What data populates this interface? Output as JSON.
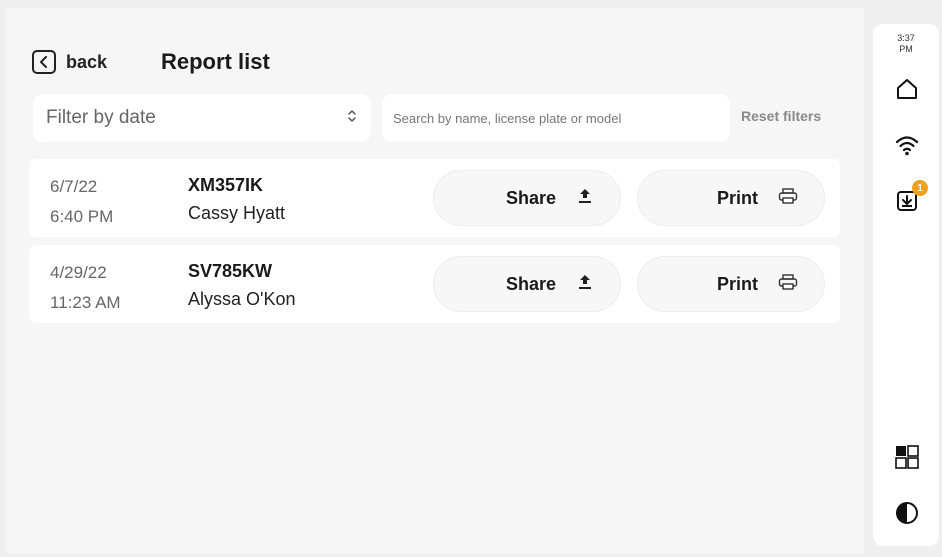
{
  "header": {
    "back_label": "back",
    "title": "Report list"
  },
  "filters": {
    "date_label": "Filter by date",
    "search_placeholder": "Search by name, license plate or model",
    "reset_label": "Reset filters"
  },
  "reports": [
    {
      "date": "6/7/22",
      "time": "6:40 PM",
      "plate": "XM357IK",
      "name": "Cassy Hyatt",
      "share_label": "Share",
      "print_label": "Print"
    },
    {
      "date": "4/29/22",
      "time": "11:23 AM",
      "plate": "SV785KW",
      "name": "Alyssa O'Kon",
      "share_label": "Share",
      "print_label": "Print"
    }
  ],
  "sidebar": {
    "time": "3:37",
    "ampm": "PM",
    "downloads_badge": "1",
    "icons": [
      "home-icon",
      "wifi-icon",
      "download-icon",
      "grid-icon",
      "contrast-icon"
    ]
  },
  "colors": {
    "badge": "#f0a020",
    "background": "#efefef",
    "card": "#ffffff"
  }
}
